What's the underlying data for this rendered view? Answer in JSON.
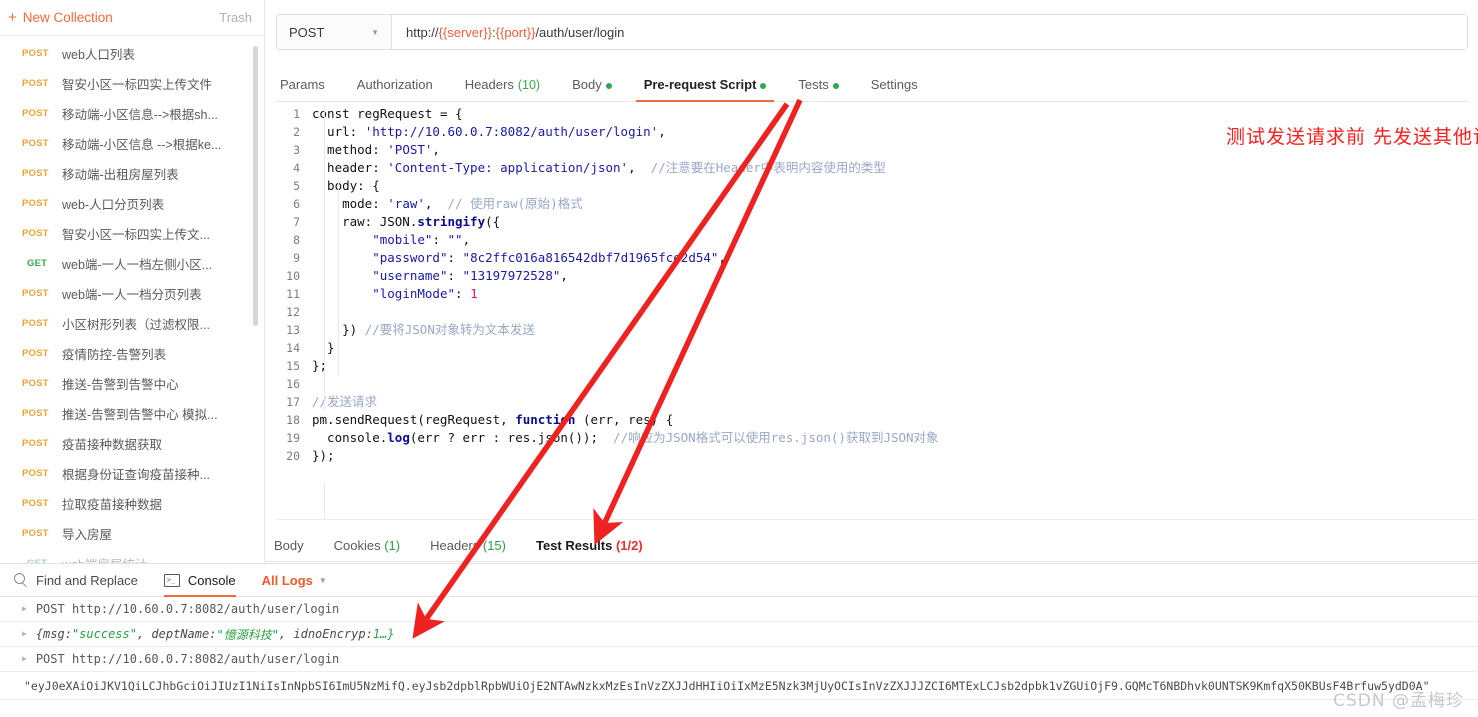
{
  "sidebar": {
    "new_collection_label": "New Collection",
    "plus_icon": "plus-icon",
    "trash_label": "Trash",
    "requests": [
      {
        "method": "POST",
        "name": "web人口列表"
      },
      {
        "method": "POST",
        "name": "智安小区一标四实上传文件"
      },
      {
        "method": "POST",
        "name": "移动端-小区信息-->根据sh..."
      },
      {
        "method": "POST",
        "name": "移动端-小区信息 -->根据ke..."
      },
      {
        "method": "POST",
        "name": "移动端-出租房屋列表"
      },
      {
        "method": "POST",
        "name": "web-人口分页列表"
      },
      {
        "method": "POST",
        "name": "智安小区一标四实上传文..."
      },
      {
        "method": "GET",
        "name": "web端-一人一档左侧小区..."
      },
      {
        "method": "POST",
        "name": "web端-一人一档分页列表"
      },
      {
        "method": "POST",
        "name": "小区树形列表（过滤权限..."
      },
      {
        "method": "POST",
        "name": "疫情防控-告警列表"
      },
      {
        "method": "POST",
        "name": "推送-告警到告警中心"
      },
      {
        "method": "POST",
        "name": "推送-告警到告警中心 模拟..."
      },
      {
        "method": "POST",
        "name": "疫苗接种数据获取"
      },
      {
        "method": "POST",
        "name": "根据身份证查询疫苗接种..."
      },
      {
        "method": "POST",
        "name": "拉取疫苗接种数据"
      },
      {
        "method": "POST",
        "name": "导入房屋"
      },
      {
        "method": "GET",
        "name": "web端房屋统计"
      }
    ]
  },
  "request": {
    "method": "POST",
    "url_prefix": "http://",
    "url_var_server": "{{server}}",
    "url_sep": ":",
    "url_var_port": "{{port}}",
    "url_path": "/auth/user/login",
    "tabs": [
      {
        "label": "Params",
        "count": "",
        "dot": false,
        "active": false
      },
      {
        "label": "Authorization",
        "count": "",
        "dot": false,
        "active": false
      },
      {
        "label": "Headers",
        "count": "(10)",
        "dot": false,
        "active": false
      },
      {
        "label": "Body",
        "count": "",
        "dot": true,
        "active": false
      },
      {
        "label": "Pre-request Script",
        "count": "",
        "dot": true,
        "active": true
      },
      {
        "label": "Tests",
        "count": "",
        "dot": true,
        "active": false
      },
      {
        "label": "Settings",
        "count": "",
        "dot": false,
        "active": false
      }
    ]
  },
  "editor": {
    "lines": [
      {
        "n": "1",
        "tokens": [
          {
            "t": "const ",
            "c": "k-plain"
          },
          {
            "t": "regRequest ",
            "c": "k-plain"
          },
          {
            "t": "= {",
            "c": "k-plain"
          }
        ]
      },
      {
        "n": "2",
        "tokens": [
          {
            "t": "  url: ",
            "c": "k-plain"
          },
          {
            "t": "'http://10.60.0.7:8082/auth/user/login'",
            "c": "k-str"
          },
          {
            "t": ",",
            "c": "k-plain"
          }
        ]
      },
      {
        "n": "3",
        "tokens": [
          {
            "t": "  method: ",
            "c": "k-plain"
          },
          {
            "t": "'POST'",
            "c": "k-str"
          },
          {
            "t": ",",
            "c": "k-plain"
          }
        ]
      },
      {
        "n": "4",
        "tokens": [
          {
            "t": "  header: ",
            "c": "k-plain"
          },
          {
            "t": "'Content-Type: application/json'",
            "c": "k-str"
          },
          {
            "t": ",  ",
            "c": "k-plain"
          },
          {
            "t": "//注意要在Header中表明内容使用的类型",
            "c": "k-cmt"
          }
        ]
      },
      {
        "n": "5",
        "tokens": [
          {
            "t": "  body: {",
            "c": "k-plain"
          }
        ]
      },
      {
        "n": "6",
        "tokens": [
          {
            "t": "    mode: ",
            "c": "k-plain"
          },
          {
            "t": "'raw'",
            "c": "k-str"
          },
          {
            "t": ",  ",
            "c": "k-plain"
          },
          {
            "t": "// 使用raw(原始)格式",
            "c": "k-cmt"
          }
        ]
      },
      {
        "n": "7",
        "tokens": [
          {
            "t": "    raw: JSON.",
            "c": "k-plain"
          },
          {
            "t": "stringify",
            "c": "k-fn"
          },
          {
            "t": "({",
            "c": "k-plain"
          }
        ]
      },
      {
        "n": "8",
        "tokens": [
          {
            "t": "        ",
            "c": "k-plain"
          },
          {
            "t": "\"mobile\"",
            "c": "k-key"
          },
          {
            "t": ": ",
            "c": "k-plain"
          },
          {
            "t": "\"\"",
            "c": "k-key"
          },
          {
            "t": ",",
            "c": "k-plain"
          }
        ]
      },
      {
        "n": "9",
        "tokens": [
          {
            "t": "        ",
            "c": "k-plain"
          },
          {
            "t": "\"password\"",
            "c": "k-key"
          },
          {
            "t": ": ",
            "c": "k-plain"
          },
          {
            "t": "\"8c2ffc016a816542dbf7d1965fce2d54\"",
            "c": "k-key"
          },
          {
            "t": ",",
            "c": "k-plain"
          }
        ]
      },
      {
        "n": "10",
        "tokens": [
          {
            "t": "        ",
            "c": "k-plain"
          },
          {
            "t": "\"username\"",
            "c": "k-key"
          },
          {
            "t": ": ",
            "c": "k-plain"
          },
          {
            "t": "\"13197972528\"",
            "c": "k-key"
          },
          {
            "t": ",",
            "c": "k-plain"
          }
        ]
      },
      {
        "n": "11",
        "tokens": [
          {
            "t": "        ",
            "c": "k-plain"
          },
          {
            "t": "\"loginMode\"",
            "c": "k-key"
          },
          {
            "t": ": ",
            "c": "k-plain"
          },
          {
            "t": "1",
            "c": "k-num"
          }
        ]
      },
      {
        "n": "12",
        "tokens": [
          {
            "t": "",
            "c": "k-plain"
          }
        ]
      },
      {
        "n": "13",
        "tokens": [
          {
            "t": "    }) ",
            "c": "k-plain"
          },
          {
            "t": "//要将JSON对象转为文本发送",
            "c": "k-cmt"
          }
        ]
      },
      {
        "n": "14",
        "tokens": [
          {
            "t": "  }",
            "c": "k-plain"
          }
        ]
      },
      {
        "n": "15",
        "tokens": [
          {
            "t": "};",
            "c": "k-plain"
          }
        ]
      },
      {
        "n": "16",
        "tokens": [
          {
            "t": "",
            "c": "k-plain"
          }
        ]
      },
      {
        "n": "17",
        "tokens": [
          {
            "t": "//发送请求",
            "c": "k-cmt"
          }
        ]
      },
      {
        "n": "18",
        "tokens": [
          {
            "t": "pm.sendRequest(regRequest, ",
            "c": "k-plain"
          },
          {
            "t": "function",
            "c": "k-fn"
          },
          {
            "t": " (err, res) {",
            "c": "k-plain"
          }
        ]
      },
      {
        "n": "19",
        "tokens": [
          {
            "t": "  console.",
            "c": "k-plain"
          },
          {
            "t": "log",
            "c": "k-fn"
          },
          {
            "t": "(err ? err : res.json());  ",
            "c": "k-plain"
          },
          {
            "t": "//响应为JSON格式可以使用res.json()获取到JSON对象",
            "c": "k-cmt"
          }
        ]
      },
      {
        "n": "20",
        "tokens": [
          {
            "t": "});",
            "c": "k-plain"
          }
        ]
      }
    ]
  },
  "annotations": {
    "top_note": "测试发送请求前 先发送其他请求",
    "note_color": "#ff1f1f",
    "arrow_color": "#ef2222"
  },
  "response": {
    "tabs": [
      {
        "label": "Body",
        "count": "",
        "count_color": "",
        "active": false
      },
      {
        "label": "Cookies",
        "count": "(1)",
        "count_color": "green",
        "active": false
      },
      {
        "label": "Headers",
        "count": "(15)",
        "count_color": "green",
        "active": false
      },
      {
        "label": "Test Results",
        "count": "(1/2)",
        "count_color": "red",
        "active": true
      }
    ]
  },
  "console": {
    "find_replace_label": "Find and Replace",
    "find_icon": "search-icon",
    "console_label": "Console",
    "console_icon": "terminal-icon",
    "all_logs_label": "All Logs",
    "all_logs_caret": "chevron-down-icon",
    "logs": [
      {
        "type": "request",
        "text": "POST http://10.60.0.7:8082/auth/user/login"
      },
      {
        "type": "object",
        "prefix": "{msg: ",
        "v1": "\"success\"",
        "mid1": ", deptName: ",
        "v2": "\"憶源科技\"",
        "mid2": ", idnoEncryp: ",
        "v3": "1…}"
      },
      {
        "type": "request",
        "text": "POST http://10.60.0.7:8082/auth/user/login"
      }
    ],
    "token_line": "\"eyJ0eXAiOiJKV1QiLCJhbGciOiJIUzI1NiIsInNpbSI6ImU5NzMifQ.eyJsb2dpblRpbWUiOjE2NTAwNzkxMzEsInVzZXJJdHHIiOiIxMzE5Nzk3MjUyOCIsInVzZXJJJZCI6MTExLCJsb2dpbk1vZGUiOjF9.GQMcT6NBDhvk0UNTSK9KmfqX50KBUsF4Brfuw5ydD0A\""
  },
  "watermark": "CSDN @孟梅珍"
}
